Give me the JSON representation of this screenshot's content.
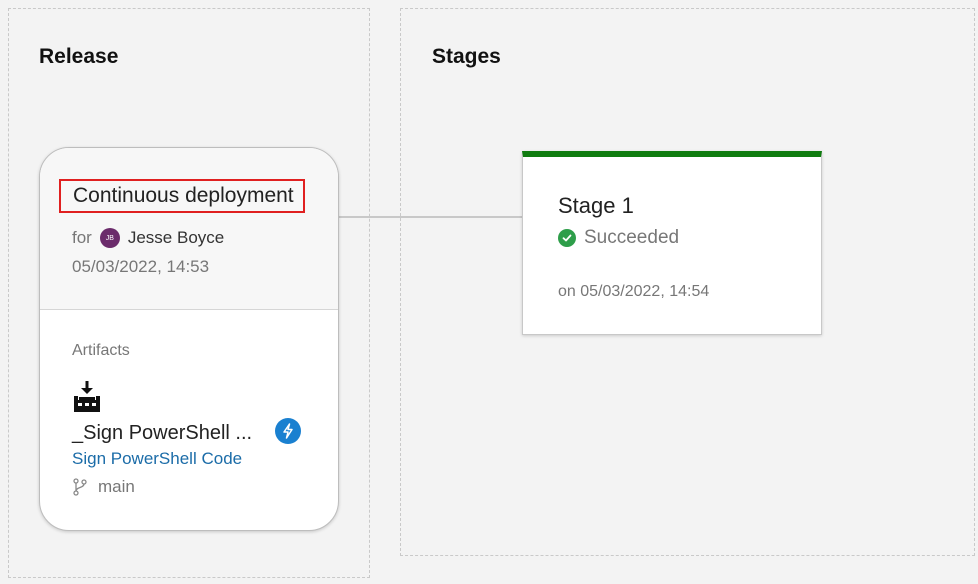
{
  "release": {
    "title": "Release",
    "trigger": "Continuous deployment",
    "for_label": "for",
    "user": {
      "name": "Jesse Boyce",
      "initials": "JB",
      "avatar_color": "#6b2b6b"
    },
    "date": "05/03/2022, 14:53",
    "artifacts_label": "Artifacts",
    "artifact": {
      "icon": "build-artifact-icon",
      "name": "_Sign PowerShell ...",
      "link": "Sign PowerShell Code",
      "branch_icon": "branch-icon",
      "branch": "main",
      "trigger_badge_icon": "lightning-icon",
      "trigger_badge_color": "#1a80d0"
    }
  },
  "stages": {
    "title": "Stages",
    "items": [
      {
        "name": "Stage 1",
        "status": "Succeeded",
        "status_icon": "check-circle-icon",
        "status_color": "#107c10",
        "date": "on 05/03/2022, 14:54"
      }
    ]
  },
  "colors": {
    "background": "#f3f3f3",
    "success": "#107c10",
    "link": "#1b6ca8",
    "highlight_border": "#e02020"
  }
}
